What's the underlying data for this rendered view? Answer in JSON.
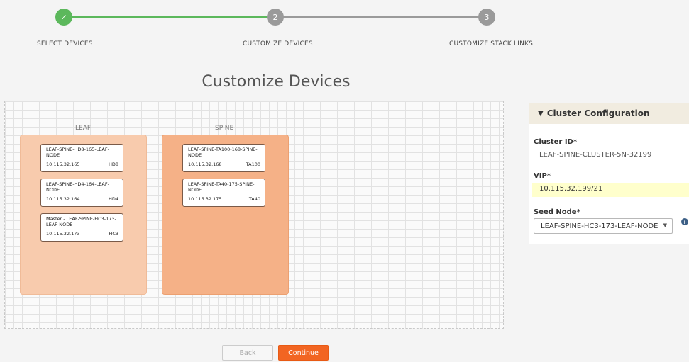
{
  "stepper": {
    "steps": [
      {
        "number": "✓",
        "label": "SELECT DEVICES"
      },
      {
        "number": "2",
        "label": "CUSTOMIZE DEVICES"
      },
      {
        "number": "3",
        "label": "CUSTOMIZE STACK LINKS"
      }
    ],
    "complete_color": "#5cb85c",
    "pending_color": "#9a9a9a"
  },
  "page": {
    "title": "Customize Devices"
  },
  "groups": {
    "leaf": {
      "label": "LEAF",
      "devices": [
        {
          "name": "LEAF-SPINE-HD8-165-LEAF-NODE",
          "ip": "10.115.32.165",
          "tag": "HD8"
        },
        {
          "name": "LEAF-SPINE-HD4-164-LEAF-NODE",
          "ip": "10.115.32.164",
          "tag": "HD4"
        },
        {
          "name": "Master - LEAF-SPINE-HC3-173-LEAF-NODE",
          "ip": "10.115.32.173",
          "tag": "HC3"
        }
      ]
    },
    "spine": {
      "label": "SPINE",
      "devices": [
        {
          "name": "LEAF-SPINE-TA100-168-SPINE-NODE",
          "ip": "10.115.32.168",
          "tag": "TA100"
        },
        {
          "name": "LEAF-SPINE-TA40-175-SPINE-NODE",
          "ip": "10.115.32.175",
          "tag": "TA40"
        }
      ]
    }
  },
  "cluster": {
    "header": "Cluster Configuration",
    "cluster_id_label": "Cluster ID*",
    "cluster_id_value": "LEAF-SPINE-CLUSTER-5N-32199",
    "vip_label": "VIP*",
    "vip_value": "10.115.32.199/21",
    "seed_label": "Seed Node*",
    "seed_value": "LEAF-SPINE-HC3-173-LEAF-NODE",
    "info_icon": "i"
  },
  "actions": {
    "back_label": "Back",
    "continue_label": "Continue",
    "accent": "#f26522"
  }
}
